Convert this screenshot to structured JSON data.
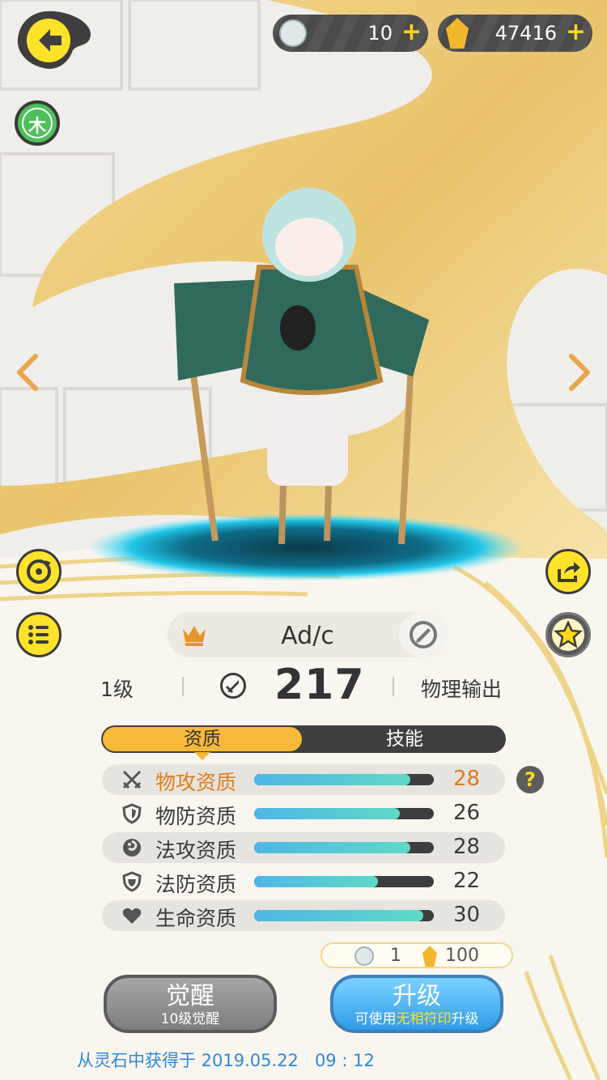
{
  "currency": {
    "tokens": {
      "value": "10",
      "icon": "character-token-icon"
    },
    "crystals": {
      "value": "47416",
      "icon": "gold-crystal-icon"
    }
  },
  "element_badge": "木",
  "character": {
    "name": "Ad/c",
    "level": "1级",
    "power": "217",
    "role": "物理输出"
  },
  "tabs": {
    "active": "资质",
    "inactive": "技能"
  },
  "stats": [
    {
      "label": "物攻资质",
      "value": "28",
      "fill": 0.87,
      "icon": "swords-icon",
      "highlighted": true
    },
    {
      "label": "物防资质",
      "value": "26",
      "fill": 0.81,
      "icon": "shield-icon",
      "highlighted": false
    },
    {
      "label": "法攻资质",
      "value": "28",
      "fill": 0.87,
      "icon": "magic-swirl-icon",
      "highlighted": false
    },
    {
      "label": "法防资质",
      "value": "22",
      "fill": 0.69,
      "icon": "magic-shield-icon",
      "highlighted": false
    },
    {
      "label": "生命资质",
      "value": "30",
      "fill": 0.94,
      "icon": "heart-icon",
      "highlighted": false
    }
  ],
  "cost": {
    "tokens": "1",
    "crystals": "100"
  },
  "buttons": {
    "awaken": {
      "title": "觉醒",
      "subtitle": "10级觉醒"
    },
    "upgrade": {
      "title": "升级",
      "subtitle_prefix": "可使用",
      "subtitle_highlight": "无相符印",
      "subtitle_suffix": "升级"
    }
  },
  "footer": "从灵石中获得于 2019.05.22   09 : 12",
  "colors": {
    "accent_yellow": "#ffe32a",
    "highlight_orange": "#e07b1a",
    "upgrade_blue": "#2f9be8",
    "bar_teal": "#5ed9c6"
  }
}
